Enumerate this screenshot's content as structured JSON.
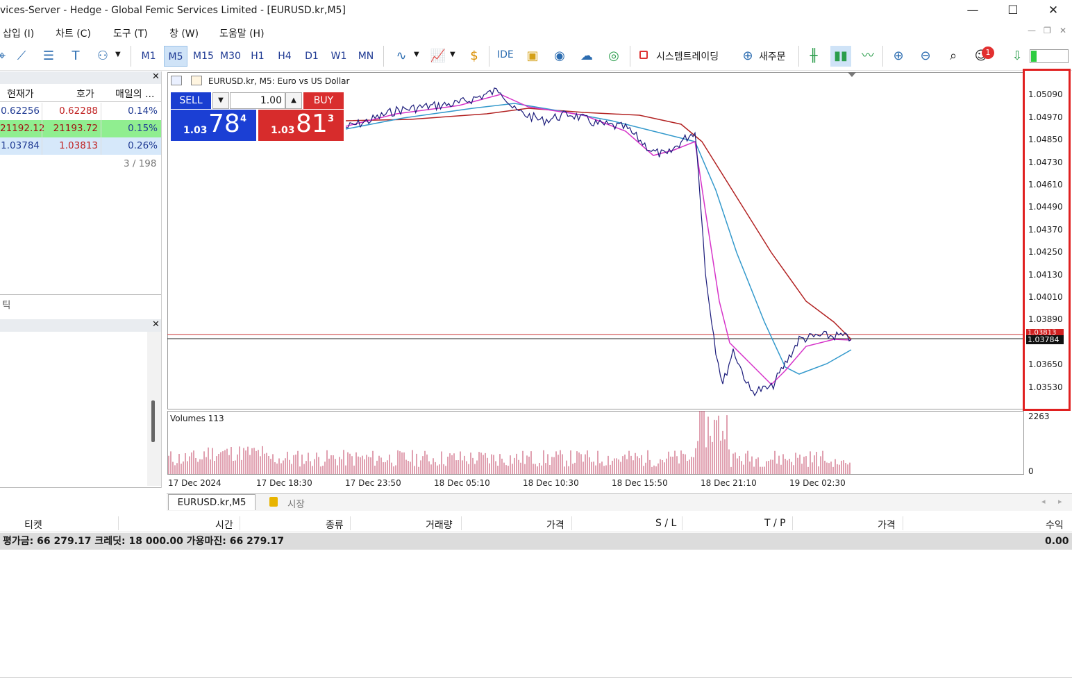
{
  "window": {
    "title": "vices-Server - Hedge - Global Femic Services Limited - [EURUSD.kr,M5]",
    "minimize": "—",
    "maximize": "☐",
    "close": "✕"
  },
  "menu": [
    "삽입 (I)",
    "차트 (C)",
    "도구 (T)",
    "창 (W)",
    "도움말 (H)"
  ],
  "toolbar": {
    "timeframes": [
      "M1",
      "M5",
      "M15",
      "M30",
      "H1",
      "H4",
      "D1",
      "W1",
      "MN"
    ],
    "active_timeframe": "M5",
    "ide_label": "IDE",
    "algo_label": "시스템트레이딩",
    "new_order_label": "새주문",
    "notification_count": "1"
  },
  "market_watch": {
    "columns": [
      "현재가",
      "호가",
      "매일의 ..."
    ],
    "rows": [
      {
        "bid": "0.62256",
        "ask": "0.62288",
        "change": "0.14%"
      },
      {
        "bid": "21192.12",
        "ask": "21193.72",
        "change": "0.15%"
      },
      {
        "bid": "1.03784",
        "ask": "1.03813",
        "change": "0.26%"
      }
    ],
    "count": "3 / 198",
    "tick_tab": "틱"
  },
  "chart": {
    "symbol_title": "EURUSD.kr, M5:  Euro vs US Dollar",
    "sell_label": "SELL",
    "buy_label": "BUY",
    "volume_value": "1.00",
    "sell_price": {
      "prefix": "1.03",
      "big": "78",
      "sup": "4"
    },
    "buy_price": {
      "prefix": "1.03",
      "big": "81",
      "sup": "3"
    },
    "price_axis": [
      "1.05090",
      "1.04970",
      "1.04850",
      "1.04730",
      "1.04610",
      "1.04490",
      "1.04370",
      "1.04250",
      "1.04130",
      "1.04010",
      "1.03890",
      "1.03650",
      "1.03530"
    ],
    "current_price_label": "1.03784",
    "ask_price_label": "1.03813",
    "time_axis": [
      "17 Dec 2024",
      "17 Dec 18:30",
      "17 Dec 23:50",
      "18 Dec 05:10",
      "18 Dec 10:30",
      "18 Dec 15:50",
      "18 Dec 21:10",
      "19 Dec 02:30"
    ],
    "volumes_label": "Volumes 113",
    "volume_axis_max": "2263",
    "volume_axis_min": "0"
  },
  "colors": {
    "price_line": "#1a1a7a",
    "ma_fast": "#d633c9",
    "ma_mid": "#3399cc",
    "ma_slow": "#b22222",
    "volume": "#c04060"
  },
  "tabs": {
    "chart_tab": "EURUSD.kr,M5",
    "market_tab": "시장"
  },
  "terminal": {
    "columns": [
      "티켓",
      "시간",
      "종류",
      "거래량",
      "가격",
      "S / L",
      "T / P",
      "가격",
      "수익"
    ],
    "balance_text": "평가금: 66 279.17  크레딧: 18 000.00  가용마진: 66 279.17",
    "profit": "0.00"
  }
}
